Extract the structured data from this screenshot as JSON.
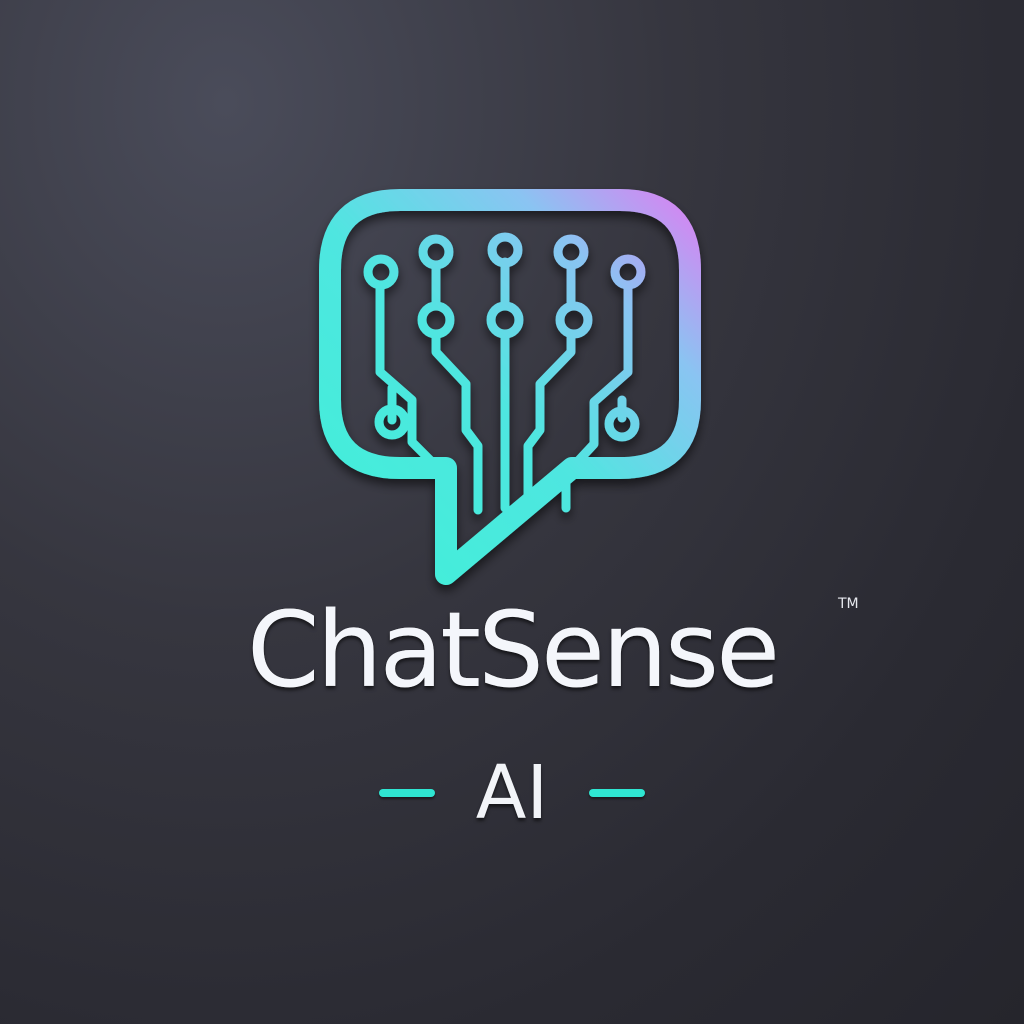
{
  "logo": {
    "icon": "chat-bubble-circuit-icon",
    "brand_name": "ChatSense",
    "trademark": "TM",
    "tagline": "AI"
  },
  "colors": {
    "background": "#2e2e36",
    "gradient_start": "#3ff0d8",
    "gradient_mid": "#6fd3e8",
    "gradient_end": "#d77cf0",
    "tagline_dash": "#2fe6d2",
    "text": "#f4f6fb"
  }
}
